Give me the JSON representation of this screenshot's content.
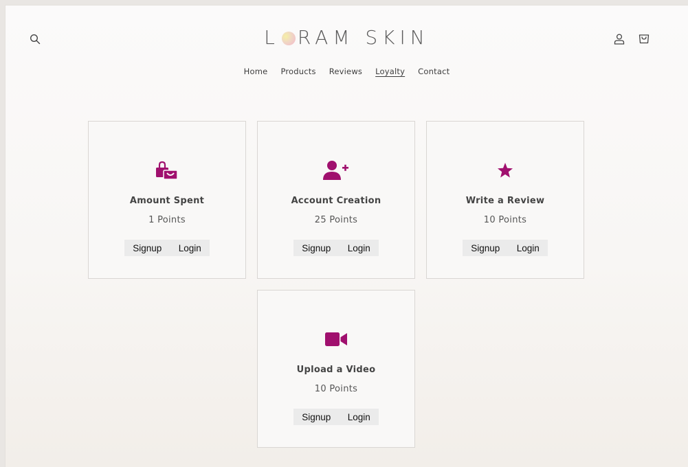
{
  "brand": {
    "name_start": "L",
    "name_end": "RAM SKIN",
    "accent": "#a0106e"
  },
  "header": {
    "search_icon": "search-icon",
    "account_icon": "user-icon",
    "cart_icon": "cart-icon"
  },
  "nav": {
    "items": [
      {
        "label": "Home"
      },
      {
        "label": "Products"
      },
      {
        "label": "Reviews"
      },
      {
        "label": "Loyalty",
        "active": true
      },
      {
        "label": "Contact"
      }
    ]
  },
  "cards": [
    {
      "icon": "shopping-bag-icon",
      "title": "Amount Spent",
      "points": "1 Points",
      "signup": "Signup",
      "login": "Login"
    },
    {
      "icon": "user-plus-icon",
      "title": "Account Creation",
      "points": "25 Points",
      "signup": "Signup",
      "login": "Login"
    },
    {
      "icon": "star-icon",
      "title": "Write a Review",
      "points": "10 Points",
      "signup": "Signup",
      "login": "Login"
    },
    {
      "icon": "video-camera-icon",
      "title": "Upload a Video",
      "points": "10 Points",
      "signup": "Signup",
      "login": "Login"
    }
  ]
}
